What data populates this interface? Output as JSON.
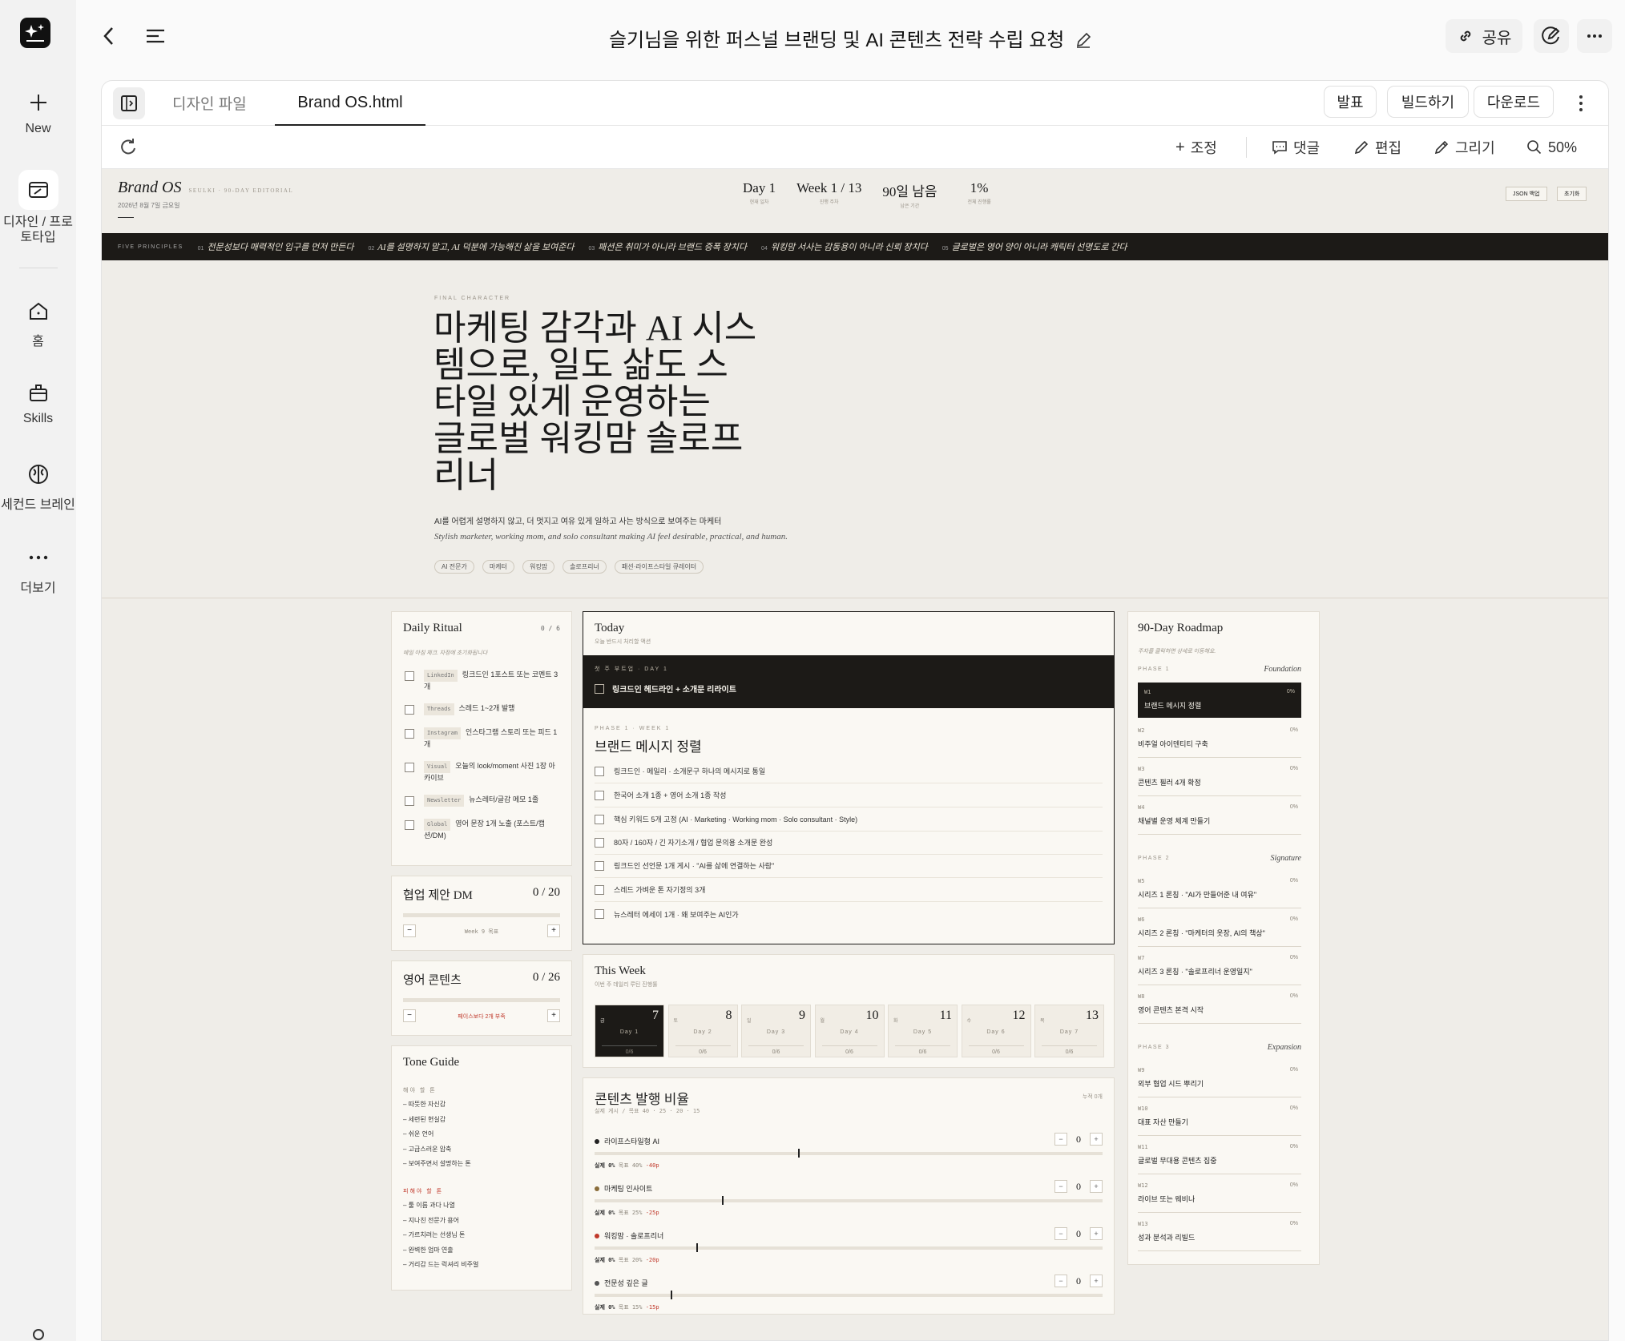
{
  "rail": {
    "new_label": "New",
    "design_label": "디자인 / 프로\n토타입",
    "home_label": "홈",
    "skills_label": "Skills",
    "brain_label": "세컨드 브레인",
    "more_label": "더보기"
  },
  "topbar": {
    "title": "슬기님을 위한 퍼스널 브랜딩 및 AI 콘텐츠 전략 수립 요청",
    "share_label": "공유"
  },
  "tabs": {
    "design_files": "디자인 파일",
    "active_file": "Brand OS.html",
    "present": "발표",
    "build": "빌드하기",
    "download": "다운로드"
  },
  "tools": {
    "adjust": "조정",
    "comment": "댓글",
    "edit": "편집",
    "draw": "그리기",
    "zoom": "50%"
  },
  "doc": {
    "brand": "Brand OS",
    "brand_sub": "SEULKI · 90-DAY EDITORIAL",
    "date": "2026년 8월 7일 금요일",
    "stats": [
      {
        "value": "Day 1",
        "label": "현재 일차"
      },
      {
        "value": "Week 1 / 13",
        "label": "진행 주차"
      },
      {
        "value": "90일 남음",
        "label": "남은 기간"
      },
      {
        "value": "1%",
        "label": "전체 진행률"
      }
    ],
    "json_backup": "JSON 백업",
    "reset": "초기화",
    "principles_label": "FIVE PRINCIPLES",
    "principles": [
      {
        "n": "01",
        "t": "전문성보다 매력적인 입구를 먼저 만든다"
      },
      {
        "n": "02",
        "t": "AI를 설명하지 말고, AI 덕분에 가능해진 삶을 보여준다"
      },
      {
        "n": "03",
        "t": "패션은 취미가 아니라 브랜드 증폭 장치다"
      },
      {
        "n": "04",
        "t": "워킹맘 서사는 감동용이 아니라 신뢰 장치다"
      },
      {
        "n": "05",
        "t": "글로벌은 영어 양이 아니라 캐릭터 선명도로 간다"
      }
    ],
    "hero": {
      "eyebrow": "FINAL CHARACTER",
      "headline_lines": [
        "마케팅 감각과 AI 시스",
        "템으로, 일도 삶도 스",
        "타일 있게 운영하는",
        "글로벌 워킹맘 솔로프",
        "리너"
      ],
      "sub_ko": "AI를 어렵게 설명하지 않고, 더 멋지고 여유 있게 일하고 사는 방식으로 보여주는 마케터",
      "sub_en": "Stylish marketer, working mom, and solo consultant making AI feel desirable, practical, and human.",
      "tags": [
        "AI 전문가",
        "마케터",
        "워킹맘",
        "솔로프리너",
        "패션·라이프스타일 큐레이터"
      ]
    },
    "ritual": {
      "title": "Daily Ritual",
      "count": "0 / 6",
      "hint": "매일 아침 체크. 자정에 초기화됩니다",
      "items": [
        {
          "tag": "LinkedIn",
          "text": "링크드인 1포스트 또는 코멘트 3개"
        },
        {
          "tag": "Threads",
          "text": "스레드 1~2개 발행"
        },
        {
          "tag": "Instagram",
          "text": "인스타그램 스토리 또는 피드 1개"
        },
        {
          "tag": "Visual",
          "text": "오늘의 look/moment 사진 1장 아카이브"
        },
        {
          "tag": "Newsletter",
          "text": "뉴스레터/글감 메모 1줄"
        },
        {
          "tag": "Global",
          "text": "영어 문장 1개 노출 (포스트/캡션/DM)"
        }
      ]
    },
    "collab": {
      "title": "협업 제안 DM",
      "count": "0 / 20",
      "goal": "Week 9 목표"
    },
    "english": {
      "title": "영어 콘텐츠",
      "count": "0 / 26",
      "goal": "페이스보다 2개 부족"
    },
    "tone": {
      "title": "Tone Guide",
      "do_label": "해야 할 톤",
      "do": [
        "따뜻한 자신감",
        "세련된 현실감",
        "쉬운 언어",
        "고급스러운 압축",
        "보여주면서 설명하는 톤"
      ],
      "dont_label": "피해야 할 톤",
      "dont": [
        "툴 이름 과다 나열",
        "지나친 전문가 용어",
        "가르치려는 선생님 톤",
        "완벽한 엄마 연출",
        "거리감 드는 럭셔리 비주얼"
      ]
    },
    "today": {
      "title": "Today",
      "sub": "오늘 반드시 처리할 액션",
      "focus_label": "첫 주 부트업 · DAY 1",
      "focus_task": "링크드인 헤드라인 + 소개문 리라이트",
      "phase_label": "PHASE 1 · WEEK 1",
      "phase_title": "브랜드 메시지 정렬",
      "tasks": [
        "링크드인 · 메일리 · 소개문구 하나의 메시지로 통일",
        "한국어 소개 1종 + 영어 소개 1종 작성",
        "핵심 키워드 5개 고정 (AI · Marketing · Working mom · Solo consultant · Style)",
        "80자 / 160자 / 긴 자기소개 / 협업 문의용 소개문 완성",
        "링크드인 선언문 1개 게시 · \"AI를 삶에 연결하는 사람\"",
        "스레드 가벼운 톤 자기정의 3개",
        "뉴스레터 에세이 1개 · 왜 보여주는 AI인가"
      ]
    },
    "week": {
      "title": "This Week",
      "sub": "이번 주 데일리 루틴 진행률",
      "days": [
        {
          "wd": "금",
          "num": "7",
          "label": "Day 1",
          "prog": "0/6"
        },
        {
          "wd": "토",
          "num": "8",
          "label": "Day 2",
          "prog": "0/6"
        },
        {
          "wd": "일",
          "num": "9",
          "label": "Day 3",
          "prog": "0/6"
        },
        {
          "wd": "월",
          "num": "10",
          "label": "Day 4",
          "prog": "0/6"
        },
        {
          "wd": "화",
          "num": "11",
          "label": "Day 5",
          "prog": "0/6"
        },
        {
          "wd": "수",
          "num": "12",
          "label": "Day 6",
          "prog": "0/6"
        },
        {
          "wd": "목",
          "num": "13",
          "label": "Day 7",
          "prog": "0/6"
        }
      ]
    },
    "mix": {
      "title": "콘텐츠 발행 비율",
      "sub": "실제 게시 / 목표 40 · 25 · 20 · 15",
      "cum": "누적 0개",
      "rows": [
        {
          "name": "라이프스타일형 AI",
          "value": "0",
          "actual": "실제 0%",
          "target": "목표 40%",
          "gap": "-40p",
          "target_pct": 40,
          "color": "#222222"
        },
        {
          "name": "마케팅 인사이트",
          "value": "0",
          "actual": "실제 0%",
          "target": "목표 25%",
          "gap": "-25p",
          "target_pct": 25,
          "color": "#8a6d3b"
        },
        {
          "name": "워킹맘 · 솔로프리너",
          "value": "0",
          "actual": "실제 0%",
          "target": "목표 20%",
          "gap": "-20p",
          "target_pct": 20,
          "color": "#c0392b"
        },
        {
          "name": "전문성 깊은 글",
          "value": "0",
          "actual": "실제 0%",
          "target": "목표 15%",
          "gap": "-15p",
          "target_pct": 15,
          "color": "#555555"
        }
      ]
    },
    "roadmap": {
      "title": "90-Day Roadmap",
      "hint": "주차를 클릭하면 상세로 이동해요.",
      "phases": [
        {
          "label": "PHASE 1",
          "name": "Foundation"
        },
        {
          "label": "PHASE 2",
          "name": "Signature"
        },
        {
          "label": "PHASE 3",
          "name": "Expansion"
        }
      ],
      "weeks": [
        {
          "n": "W1",
          "t": "브랜드 메시지 정렬",
          "p": "0%"
        },
        {
          "n": "W2",
          "t": "비주얼 아이덴티티 구축",
          "p": "0%"
        },
        {
          "n": "W3",
          "t": "콘텐츠 필러 4개 확정",
          "p": "0%"
        },
        {
          "n": "W4",
          "t": "채널별 운영 체계 만들기",
          "p": "0%"
        },
        {
          "n": "W5",
          "t": "시리즈 1 론칭 · \"AI가 만들어준 내 여유\"",
          "p": "0%"
        },
        {
          "n": "W6",
          "t": "시리즈 2 론칭 · \"마케터의 옷장, AI의 책상\"",
          "p": "0%"
        },
        {
          "n": "W7",
          "t": "시리즈 3 론칭 · \"솔로프리너 운영일지\"",
          "p": "0%"
        },
        {
          "n": "W8",
          "t": "영어 콘텐츠 본격 시작",
          "p": "0%"
        },
        {
          "n": "W9",
          "t": "외부 협업 시드 뿌리기",
          "p": "0%"
        },
        {
          "n": "W10",
          "t": "대표 자산 만들기",
          "p": "0%"
        },
        {
          "n": "W11",
          "t": "글로벌 무대용 콘텐츠 집중",
          "p": "0%"
        },
        {
          "n": "W12",
          "t": "라이브 또는 웨비나",
          "p": "0%"
        },
        {
          "n": "W13",
          "t": "성과 분석과 리빌드",
          "p": "0%"
        }
      ]
    }
  }
}
